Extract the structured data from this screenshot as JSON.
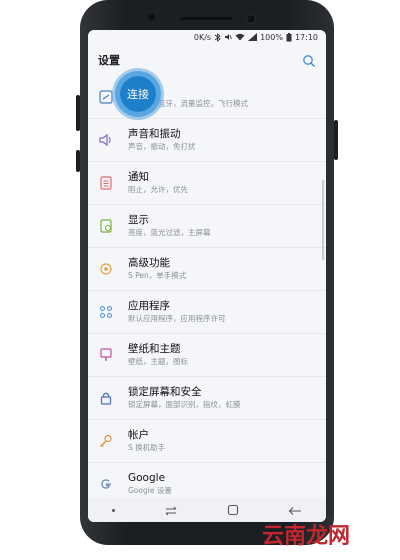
{
  "statusbar": {
    "speed": "0K/s",
    "battery": "100%",
    "time": "17:10"
  },
  "header": {
    "title": "设置"
  },
  "tap_indicator": {
    "label": "连接"
  },
  "items": [
    {
      "title": "连接",
      "subtitle": "WLAN，蓝牙，流量监控，飞行模式",
      "icon": "connection-icon"
    },
    {
      "title": "声音和振动",
      "subtitle": "声音，振动，免打扰",
      "icon": "sound-icon"
    },
    {
      "title": "通知",
      "subtitle": "阻止，允许，优先",
      "icon": "notification-icon"
    },
    {
      "title": "显示",
      "subtitle": "亮度，蓝光过滤，主屏幕",
      "icon": "display-icon"
    },
    {
      "title": "高级功能",
      "subtitle": "S Pen，单手模式",
      "icon": "advanced-icon"
    },
    {
      "title": "应用程序",
      "subtitle": "默认应用程序，应用程序许可",
      "icon": "apps-icon"
    },
    {
      "title": "壁纸和主题",
      "subtitle": "壁纸，主题，图标",
      "icon": "wallpaper-icon"
    },
    {
      "title": "锁定屏幕和安全",
      "subtitle": "锁定屏幕，面部识别，指纹，虹膜",
      "icon": "lock-icon"
    },
    {
      "title": "帐户",
      "subtitle": "S 换机助手",
      "icon": "account-icon"
    },
    {
      "title": "Google",
      "subtitle": "Google 设置",
      "icon": "google-icon"
    }
  ],
  "watermark": {
    "part1": "云南",
    "part2": "龙网"
  },
  "colors": {
    "accent": "#1d7ec9",
    "tap_ring": "#58a7e2"
  }
}
